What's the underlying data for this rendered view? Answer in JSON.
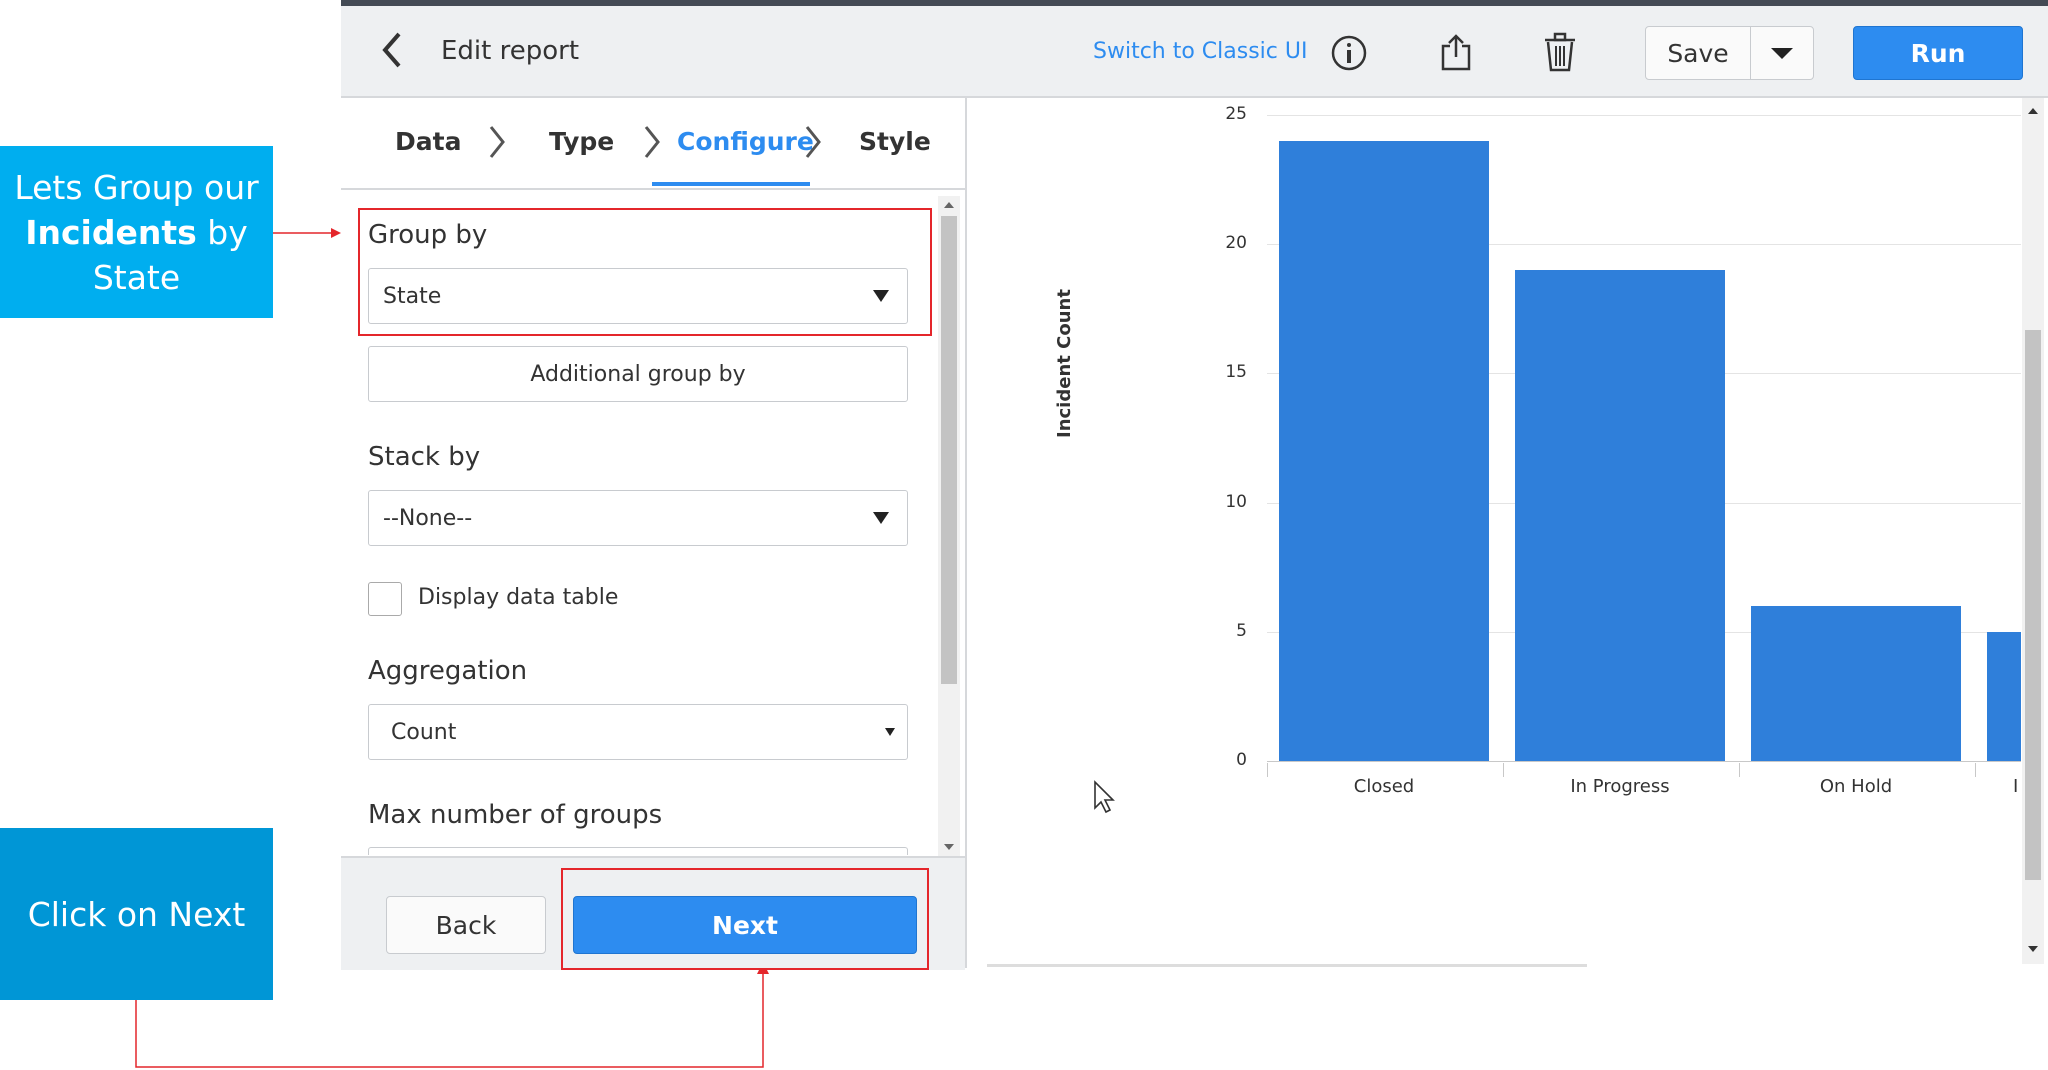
{
  "callouts": {
    "group": {
      "prefix": "Lets Group our",
      "bold": "Incidents",
      "suffix": "by State"
    },
    "next": "Click on Next"
  },
  "header": {
    "title": "Edit report",
    "switch_link": "Switch to Classic UI",
    "save": "Save",
    "run": "Run"
  },
  "tabs": [
    {
      "label": "Data"
    },
    {
      "label": "Type"
    },
    {
      "label": "Configure"
    },
    {
      "label": "Style"
    }
  ],
  "form": {
    "group_by_label": "Group by",
    "group_by_value": "State",
    "additional_group_by": "Additional group by",
    "stack_by_label": "Stack by",
    "stack_by_value": "--None--",
    "display_data_table": "Display data table",
    "aggregation_label": "Aggregation",
    "aggregation_value": "Count",
    "max_groups_label": "Max number of groups"
  },
  "footer": {
    "back": "Back",
    "next": "Next"
  },
  "chart_data": {
    "type": "bar",
    "categories": [
      "Closed",
      "In Progress",
      "On Hold",
      "I"
    ],
    "values": [
      24,
      19,
      6,
      5
    ],
    "ylabel": "Incident Count",
    "ylim": [
      0,
      25
    ],
    "yticks": [
      "0",
      "5",
      "10",
      "15",
      "20",
      "25"
    ],
    "grid": true
  },
  "colors": {
    "accent": "#2d8cf0",
    "bar": "#2f7fda",
    "callout": "#00aeef",
    "highlight": "#e4262b"
  }
}
